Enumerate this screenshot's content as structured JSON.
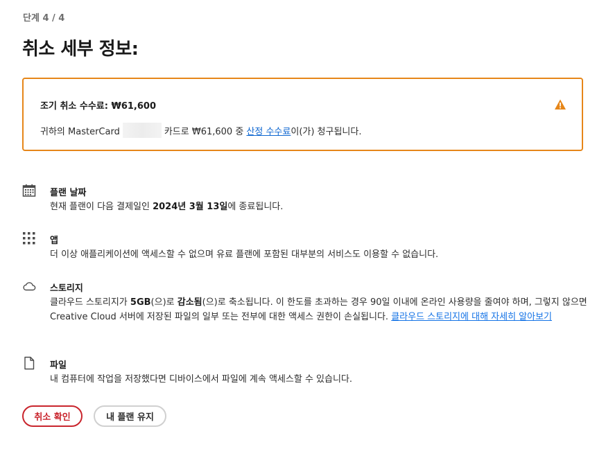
{
  "header": {
    "step": "단계 4 / 4",
    "title": "취소 세부 정보:"
  },
  "alert": {
    "title": "조기 취소 수수료: ₩61,600",
    "body_prefix": "귀하의 MasterCard",
    "body_middle": "카드로 ₩61,600 중",
    "body_link": "산정 수수료",
    "body_suffix": "이(가) 청구됩니다.",
    "icon": "warning-icon",
    "border_color": "#e68619"
  },
  "sections": {
    "plan_date": {
      "icon": "calendar-icon",
      "title": "플랜 날짜",
      "body_prefix": "현재 플랜이 다음 결제일인 ",
      "body_bold": "2024년 3월 13일",
      "body_suffix": "에 종료됩니다."
    },
    "apps": {
      "icon": "apps-grid-icon",
      "title": "앱",
      "body": "더 이상 애플리케이션에 액세스할 수 없으며 유료 플랜에 포함된 대부분의 서비스도 이용할 수 없습니다."
    },
    "storage": {
      "icon": "cloud-icon",
      "title": "스토리지",
      "body_prefix": "클라우드 스토리지가 ",
      "body_bold1": "5GB",
      "body_mid1": "(으)로 ",
      "body_bold2": "감소됨",
      "body_mid2": "(으)로 축소됩니다. 이 한도를 초과하는 경우 90일 이내에 온라인 사용량을 줄여야 하며, 그렇지 않으면 Creative Cloud 서버에 저장된 파일의 일부 또는 전부에 대한 액세스 권한이 손실됩니다. ",
      "link": "클라우드 스토리지에 대해 자세히 알아보기"
    },
    "files": {
      "icon": "file-icon",
      "title": "파일",
      "body": "내 컴퓨터에 작업을 저장했다면 디바이스에서 파일에 계속 액세스할 수 있습니다."
    }
  },
  "buttons": {
    "confirm_cancel": "취소 확인",
    "keep_plan": "내 플랜 유지"
  },
  "colors": {
    "accent_warning": "#e68619",
    "danger": "#c9252d",
    "link": "#1473e6"
  }
}
